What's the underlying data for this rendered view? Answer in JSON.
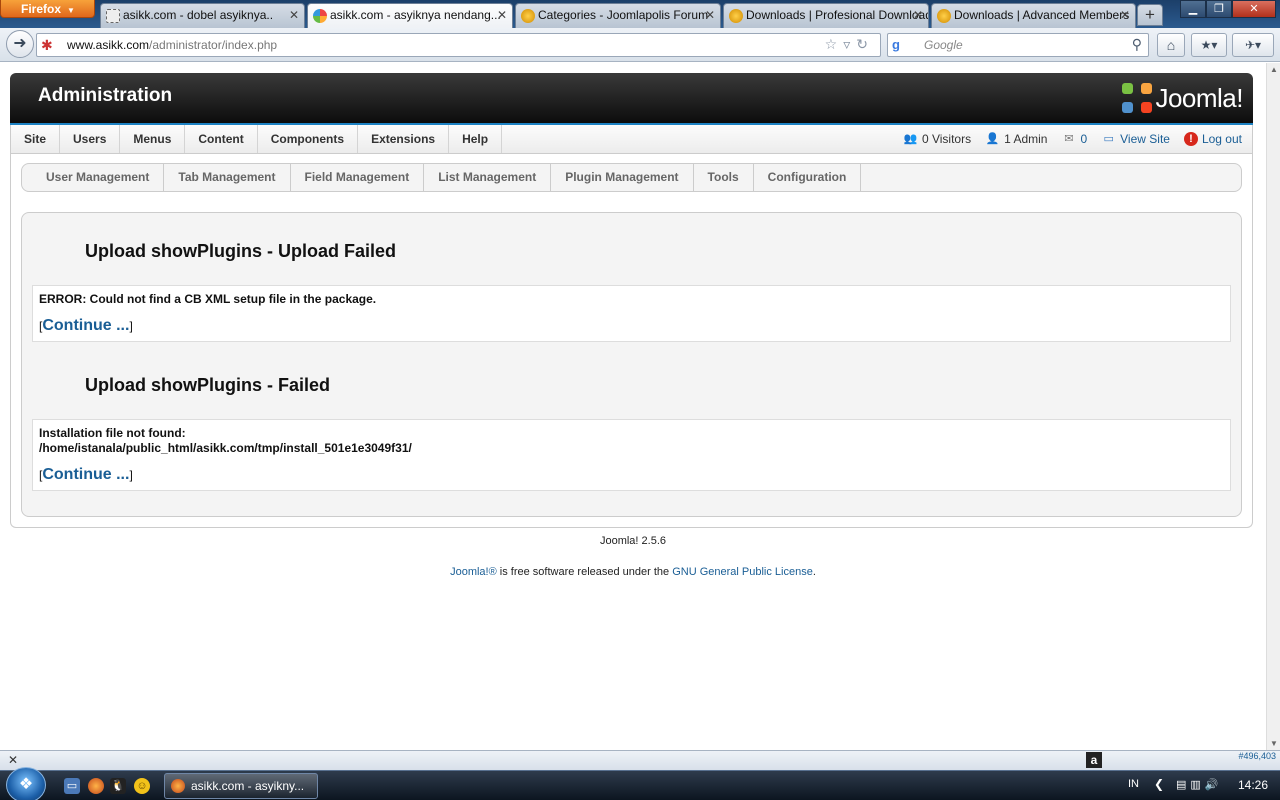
{
  "browser": {
    "app_button": "Firefox",
    "tabs": [
      {
        "title": "asikk.com - dobel asyiknya..",
        "active": false
      },
      {
        "title": "asikk.com - asyiknya nendang...",
        "active": true
      },
      {
        "title": "Categories - Joomlapolis Forum",
        "active": false
      },
      {
        "title": "Downloads | Profesional Downloads",
        "active": false
      },
      {
        "title": "Downloads | Advanced Members",
        "active": false
      }
    ],
    "url_domain": "www.asikk.com",
    "url_path": "/administrator/index.php",
    "search_placeholder": "Google"
  },
  "admin": {
    "title": "Administration",
    "logo_text": "Joomla!",
    "menu": [
      "Site",
      "Users",
      "Menus",
      "Content",
      "Components",
      "Extensions",
      "Help"
    ],
    "status": {
      "visitors": "0 Visitors",
      "admins": "1 Admin",
      "messages": "0",
      "view_site": "View Site",
      "logout": "Log out"
    },
    "submenu": [
      "User Management",
      "Tab Management",
      "Field Management",
      "List Management",
      "Plugin Management",
      "Tools",
      "Configuration"
    ]
  },
  "content": {
    "section1": {
      "title": "Upload showPlugins - Upload Failed",
      "message": "ERROR: Could not find a CB XML setup file in the package.",
      "continue_label": "Continue ..."
    },
    "section2": {
      "title": "Upload showPlugins - Failed",
      "message_line1": "Installation file not found:",
      "message_line2": "/home/istanala/public_html/asikk.com/tmp/install_501e1e3049f31/",
      "continue_label": "Continue ..."
    },
    "bracket_open": "[",
    "bracket_close": "]"
  },
  "footer": {
    "version": "Joomla! 2.5.6",
    "license_link1": "Joomla!®",
    "license_text": " is free software released under the ",
    "license_link2": "GNU General Public License",
    "license_end": "."
  },
  "addonbar": {
    "position": "#496,403"
  },
  "taskbar": {
    "active_window": "asikk.com - asyikny...",
    "language": "IN",
    "clock": "14:26"
  },
  "colors": {
    "accent_blue": "#1d82c3",
    "link_blue": "#1a5e95",
    "header_dark": "#0c0c0c"
  }
}
